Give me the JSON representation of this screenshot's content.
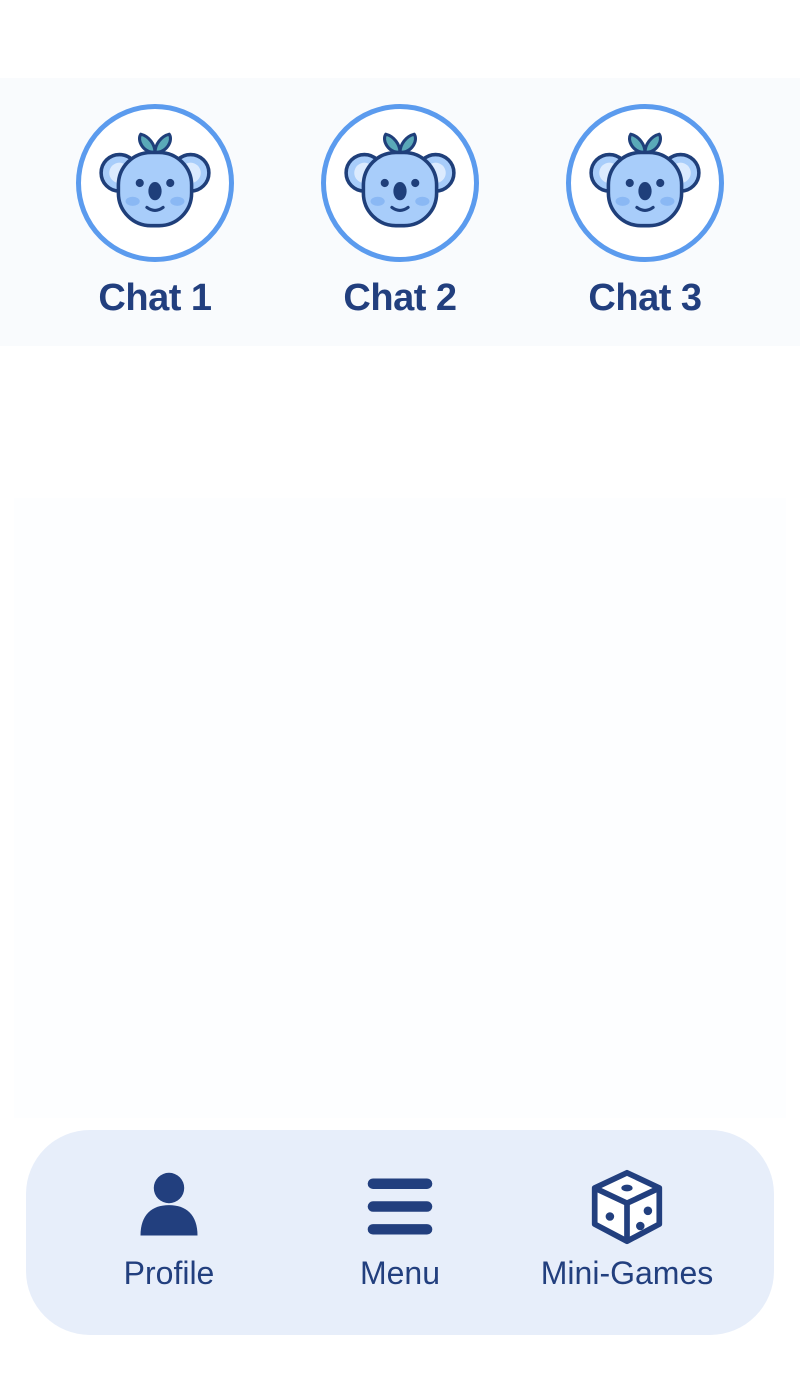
{
  "chats": [
    {
      "label": "Chat 1",
      "icon": "koala-avatar-icon"
    },
    {
      "label": "Chat 2",
      "icon": "koala-avatar-icon"
    },
    {
      "label": "Chat 3",
      "icon": "koala-avatar-icon"
    }
  ],
  "nav": {
    "profile_label": "Profile",
    "menu_label": "Menu",
    "games_label": "Mini-Games",
    "icons": [
      "person-icon",
      "hamburger-menu-icon",
      "dice-icon"
    ]
  },
  "colors": {
    "accent": "#5b9bee",
    "text": "#223f7e",
    "nav_background": "#e7eefa",
    "koala_face": "#a8cdfa",
    "leaf": "#5aa9b8"
  }
}
